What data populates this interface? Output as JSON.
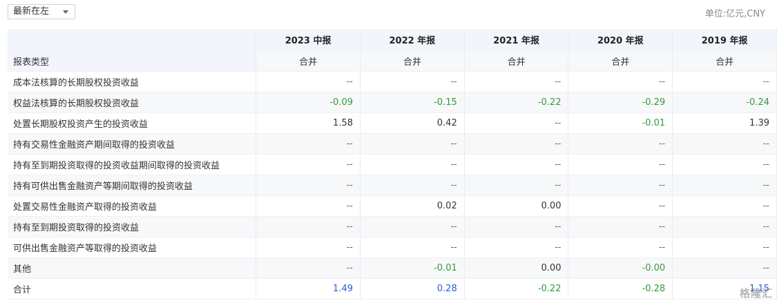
{
  "toolbar": {
    "sort_select_value": "最新在左",
    "unit_label": "单位:亿元,CNY"
  },
  "table": {
    "columns": [
      "2023 中报",
      "2022 年报",
      "2021 年报",
      "2020 年报",
      "2019 年报"
    ],
    "rows": [
      {
        "label": "报表类型",
        "values": [
          "合并",
          "合并",
          "合并",
          "合并",
          "合并"
        ]
      },
      {
        "label": "成本法核算的长期股权投资收益",
        "values": [
          "--",
          "--",
          "--",
          "--",
          "--"
        ]
      },
      {
        "label": "权益法核算的长期股权投资收益",
        "values": [
          "-0.09",
          "-0.15",
          "-0.22",
          "-0.29",
          "-0.24"
        ]
      },
      {
        "label": "处置长期股权投资产生的投资收益",
        "values": [
          "1.58",
          "0.42",
          "--",
          "-0.01",
          "1.39"
        ]
      },
      {
        "label": "持有交易性金融资产期间取得的投资收益",
        "values": [
          "--",
          "--",
          "--",
          "--",
          "--"
        ]
      },
      {
        "label": "持有至到期投资取得的投资收益期间取得的投资收益",
        "values": [
          "--",
          "--",
          "--",
          "--",
          "--"
        ]
      },
      {
        "label": "持有可供出售金融资产等期间取得的投资收益",
        "values": [
          "--",
          "--",
          "--",
          "--",
          "--"
        ]
      },
      {
        "label": "处置交易性金融资产取得的投资收益",
        "values": [
          "--",
          "0.02",
          "0.00",
          "--",
          "--"
        ]
      },
      {
        "label": "持有至到期投资取得的投资收益",
        "values": [
          "--",
          "--",
          "--",
          "--",
          "--"
        ]
      },
      {
        "label": "可供出售金融资产等取得的投资收益",
        "values": [
          "--",
          "--",
          "--",
          "--",
          "--"
        ]
      },
      {
        "label": "其他",
        "values": [
          "--",
          "-0.01",
          "0.00",
          "-0.00",
          "--"
        ]
      },
      {
        "label": "合计",
        "values": [
          "1.49",
          "0.28",
          "-0.22",
          "-0.28",
          "1.15"
        ]
      }
    ]
  },
  "colors": {
    "negative": "#2e9b3a",
    "total_positive": "#2b5bd7",
    "header_bg": "#f2f5fb"
  },
  "watermark": "格隆汇"
}
